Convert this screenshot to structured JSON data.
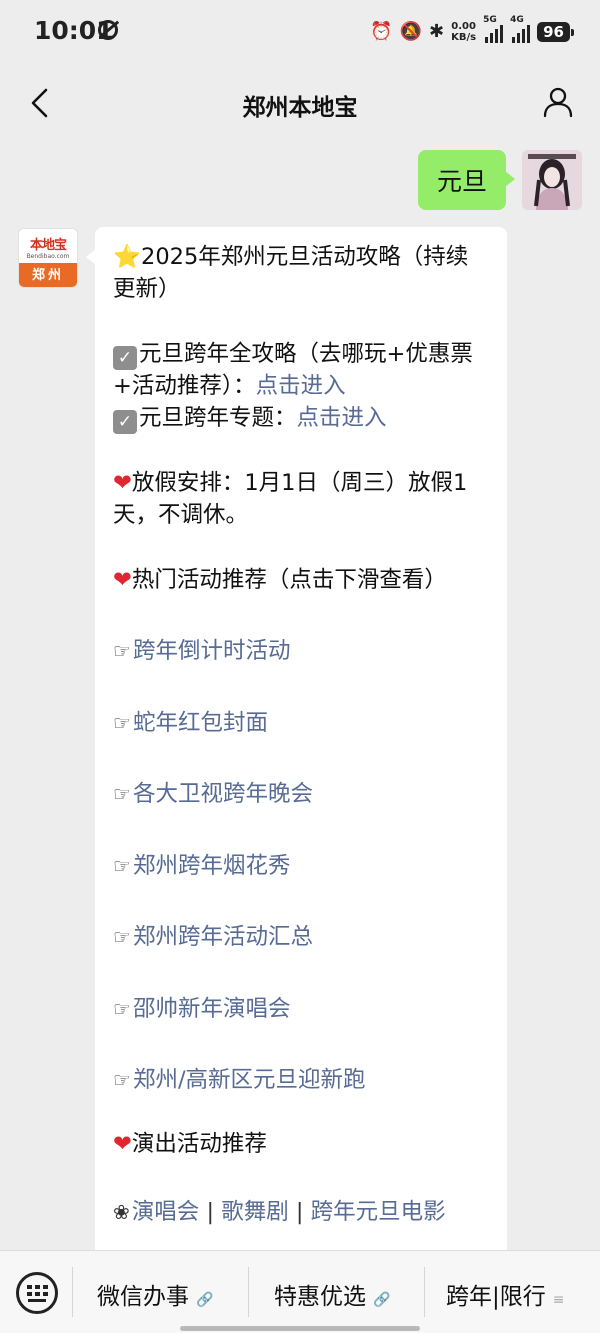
{
  "status_bar": {
    "time": "10:01",
    "net_speed_value": "0.00",
    "net_speed_unit": "KB/s",
    "sim1_label": "5G",
    "sim2_label": "4G",
    "battery": "96",
    "icons": [
      "alarm-icon",
      "mute-bell-icon",
      "bluetooth-icon"
    ]
  },
  "header": {
    "title": "郑州本地宝"
  },
  "chat": {
    "user_message": "元旦",
    "bot_avatar": {
      "brand": "本地宝",
      "url": "Bendibao.com",
      "city": "郑州"
    },
    "bot_message": {
      "title_emoji": "⭐",
      "title": "2025年郑州元旦活动攻略（持续更新）",
      "line1_text": "元旦跨年全攻略（去哪玩+优惠票+活动推荐）：",
      "line1_link": "点击进入",
      "line2_text": "元旦跨年专题：",
      "line2_link": "点击进入",
      "holiday": "放假安排：1月1日（周三）放假1天，不调休。",
      "hot_heading": "热门活动推荐（点击下滑查看）",
      "hot_links": [
        "跨年倒计时活动",
        "蛇年红包封面",
        "各大卫视跨年晚会",
        "郑州跨年烟花秀",
        "郑州跨年活动汇总",
        "邵帅新年演唱会",
        "郑州/高新区元旦迎新跑"
      ],
      "show_heading": "演出活动推荐",
      "show_links": [
        "演唱会",
        "歌舞剧",
        "跨年元旦电影"
      ],
      "separator": "|"
    }
  },
  "bottom_menu": {
    "items": [
      {
        "label": "微信办事",
        "glyph": "link-icon"
      },
      {
        "label": "特惠优选",
        "glyph": "link-icon"
      },
      {
        "label": "跨年|限行",
        "glyph": "menu-lines-icon"
      }
    ]
  }
}
